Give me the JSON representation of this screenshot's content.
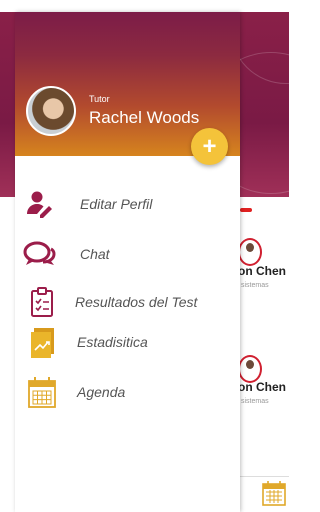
{
  "drawer": {
    "profile": {
      "role": "Tutor",
      "name": "Rachel Woods"
    },
    "fab_label": "+",
    "menu": [
      {
        "label": "Editar Perfil",
        "icon": "edit-user-icon"
      },
      {
        "label": "Chat",
        "icon": "chat-bubbles-icon"
      },
      {
        "label": "Resultados del Test",
        "icon": "clipboard-checklist-icon"
      },
      {
        "label": "Estadisitica",
        "icon": "chart-trend-icon"
      },
      {
        "label": "Agenda",
        "icon": "calendar-icon"
      }
    ]
  },
  "background": {
    "cards": [
      {
        "name": "on Chen",
        "sub": "sistemas"
      },
      {
        "name": "on Chen",
        "sub": "sistemas"
      }
    ]
  },
  "colors": {
    "primary": "#9b1d4a",
    "accent": "#f4c33a",
    "gold": "#e0a82a"
  }
}
